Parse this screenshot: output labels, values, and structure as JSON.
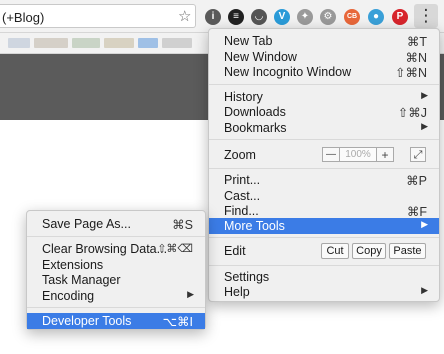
{
  "toolbar": {
    "omnibox_text": "(+Blog)",
    "star_icon": "☆",
    "menu_icon": "⋮",
    "extensions": [
      {
        "name": "info-extension-icon",
        "glyph": "i",
        "color": "#5a5a5a"
      },
      {
        "name": "buffer-extension-icon",
        "glyph": "≡",
        "color": "#222222"
      },
      {
        "name": "pocket-extension-icon",
        "glyph": "◡",
        "color": "#555555"
      },
      {
        "name": "v-extension-icon",
        "glyph": "V",
        "color": "#2a9bd8"
      },
      {
        "name": "puzzle-extension-icon",
        "glyph": "✦",
        "color": "#9a9a9a"
      },
      {
        "name": "hubspot-extension-icon",
        "glyph": "⚙",
        "color": "#999999"
      },
      {
        "name": "cb-extension-icon",
        "glyph": "CB",
        "color": "#e8673a"
      },
      {
        "name": "location-extension-icon",
        "glyph": "●",
        "color": "#3aa0d8"
      },
      {
        "name": "pinterest-extension-icon",
        "glyph": "P",
        "color": "#d7242c"
      }
    ]
  },
  "chrome_menu": {
    "items": [
      {
        "label": "New Tab",
        "shortcut": "⌘T"
      },
      {
        "label": "New Window",
        "shortcut": "⌘N"
      },
      {
        "label": "New Incognito Window",
        "shortcut": "⇧⌘N"
      },
      {
        "label": "History",
        "arrow": "▶"
      },
      {
        "label": "Downloads",
        "shortcut": "⇧⌘J"
      },
      {
        "label": "Bookmarks",
        "arrow": "▶"
      },
      {
        "label": "Print...",
        "shortcut": "⌘P"
      },
      {
        "label": "Cast..."
      },
      {
        "label": "Find...",
        "shortcut": "⌘F"
      },
      {
        "label": "More Tools",
        "arrow": "▶"
      },
      {
        "label": "Settings"
      },
      {
        "label": "Help",
        "arrow": "▶"
      }
    ],
    "zoom": {
      "label": "Zoom",
      "minus": "—",
      "value": "100%",
      "plus": "+",
      "fullscreen": "⤢"
    },
    "edit": {
      "label": "Edit",
      "cut": "Cut",
      "copy": "Copy",
      "paste": "Paste"
    }
  },
  "more_tools_menu": {
    "items": [
      {
        "label": "Save Page As...",
        "shortcut": "⌘S"
      },
      {
        "label": "Clear Browsing Data...",
        "shortcut": "⇧⌘⌫"
      },
      {
        "label": "Extensions"
      },
      {
        "label": "Task Manager"
      },
      {
        "label": "Encoding",
        "arrow": "▶"
      },
      {
        "label": "Developer Tools",
        "shortcut": "⌥⌘I"
      }
    ]
  },
  "colors": {
    "highlight": "#3b7ce6",
    "dark_band": "#5b5b5b",
    "menu_bg": "#f0f0f0"
  }
}
